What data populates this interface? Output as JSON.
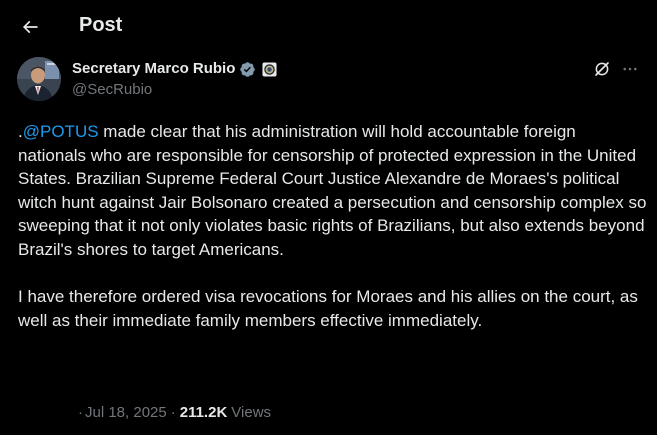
{
  "header": {
    "title": "Post"
  },
  "author": {
    "name": "Secretary Marco Rubio",
    "handle": "@SecRubio"
  },
  "post": {
    "prefix": ".",
    "mention": "@POTUS",
    "paragraph1_rest": " made clear that his administration will hold accountable foreign nationals who are responsible for censorship of protected expression in the United States. Brazilian Supreme Federal Court Justice Alexandre de Moraes's political witch hunt against Jair Bolsonaro created a persecution and censorship complex so sweeping that it not only violates basic rights of Brazilians, but also extends beyond Brazil's shores to target Americans.",
    "paragraph2": "I have therefore ordered visa revocations for Moraes and his allies on the court, as well as their immediate family members effective immediately."
  },
  "meta": {
    "lead_sep": "·",
    "date": "Jul 18, 2025",
    "sep": "·",
    "views_count": "211.2K",
    "views_label": "Views"
  },
  "icons": {
    "back": "arrow-left-icon",
    "verified": "verified-badge-icon",
    "affiliation": "government-seal-icon",
    "grok": "grok-icon",
    "more": "more-horizontal-icon"
  },
  "colors": {
    "background": "#000000",
    "text": "#e7e9ea",
    "secondary": "#71767b",
    "link": "#1d9bf0",
    "verified_badge": "#829aab"
  }
}
